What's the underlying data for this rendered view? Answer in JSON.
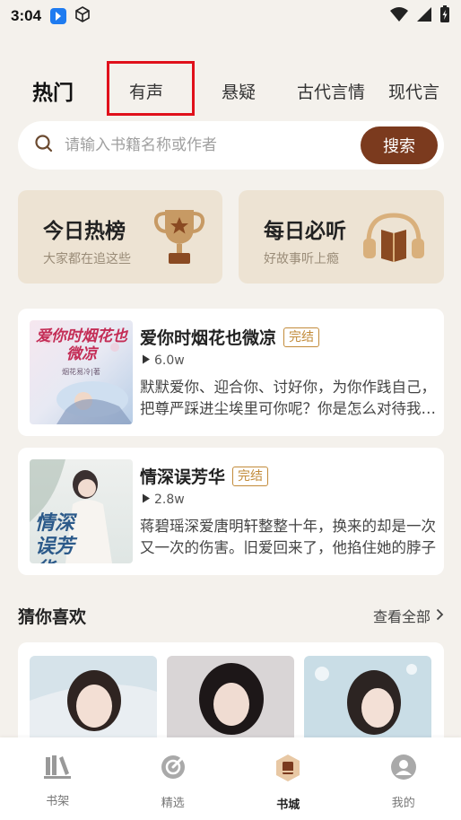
{
  "status_bar": {
    "time": "3:04"
  },
  "tabs": [
    {
      "label": "热门",
      "active": true
    },
    {
      "label": "有声",
      "active": false
    },
    {
      "label": "悬疑",
      "active": false
    },
    {
      "label": "古代言情",
      "active": false
    },
    {
      "label": "现代言",
      "active": false
    }
  ],
  "search": {
    "placeholder": "请输入书籍名称或作者",
    "button_label": "搜索"
  },
  "features": [
    {
      "title": "今日热榜",
      "subtitle": "大家都在追这些",
      "icon": "trophy-icon"
    },
    {
      "title": "每日必听",
      "subtitle": "好故事听上瘾",
      "icon": "headphones-icon"
    }
  ],
  "books": [
    {
      "title": "爱你时烟花也微凉",
      "status": "完结",
      "plays": "6.0w",
      "description": "默默爱你、迎合你、讨好你，为你作践自己，把尊严踩进尘埃里可你呢？你是怎么对待我的？",
      "cover_text": "爱你时烟花也微凉",
      "cover_sub": "烟花易冷|著"
    },
    {
      "title": "情深误芳华",
      "status": "完结",
      "plays": "2.8w",
      "description": "蒋碧瑶深爱唐明轩整整十年，换来的却是一次又一次的伤害。旧爱回来了，他掐住她的脖子",
      "cover_text": "情深误芳华"
    }
  ],
  "recommend": {
    "title": "猜你喜欢",
    "more_label": "查看全部"
  },
  "bottom_nav": [
    {
      "label": "书架",
      "icon": "bookshelf-icon",
      "active": false
    },
    {
      "label": "精选",
      "icon": "compass-icon",
      "active": false
    },
    {
      "label": "书城",
      "icon": "bookstore-icon",
      "active": true
    },
    {
      "label": "我的",
      "icon": "profile-icon",
      "active": false
    }
  ],
  "colors": {
    "accent": "#7b3a1e",
    "background": "#f4f1ec",
    "card": "#ede3d3",
    "badge": "#c28b3a",
    "highlight_box": "#e0101b"
  }
}
